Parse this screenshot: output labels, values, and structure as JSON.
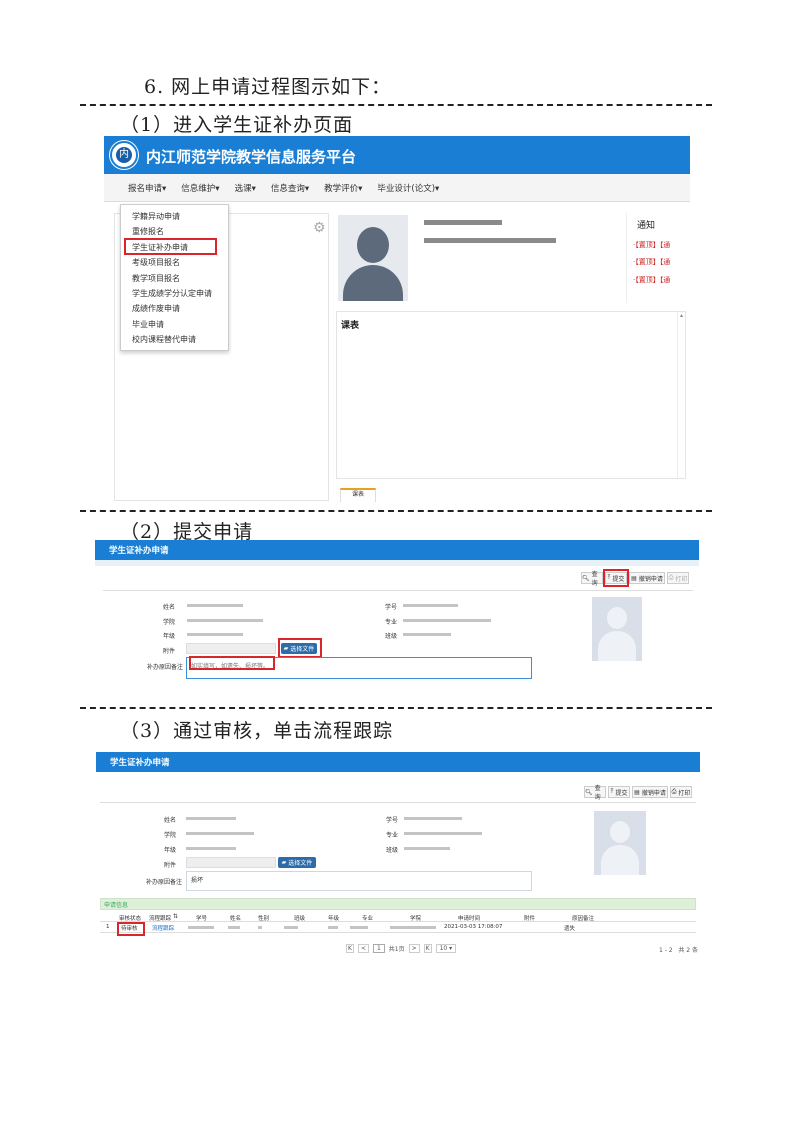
{
  "doc": {
    "title": "6. 网上申请过程图示如下：",
    "step1": "（1）进入学生证补办页面",
    "step2": "（2）提交申请",
    "step3": "（3）通过审核，单击流程跟踪"
  },
  "shot1": {
    "app_title": "内江师范学院教学信息服务平台",
    "nav": [
      "报名申请▾",
      "信息维护▾",
      "选课▾",
      "信息查询▾",
      "教学评价▾",
      "毕业设计(论文)▾"
    ],
    "menu": [
      "学籍异动申请",
      "重修报名",
      "学生证补办申请",
      "考级项目报名",
      "教学项目报名",
      "学生成绩学分认定申请",
      "成绩作废申请",
      "毕业申请",
      "校内课程替代申请"
    ],
    "notice_title": "通知",
    "notice_items": [
      "·【置顶】【通",
      "·【置顶】【通",
      "·【置顶】【通"
    ],
    "timetable_title": "课表",
    "tab_label": "课表"
  },
  "form": {
    "title": "学生证补办申请",
    "buttons": {
      "query": "查询",
      "submit": "提交",
      "cancel": "撤销申请",
      "print": "打印"
    },
    "labels": {
      "name": "姓名",
      "college": "学院",
      "grade": "年级",
      "attachment": "附件",
      "reason": "补办原因备注",
      "student_no": "学号",
      "major": "专业",
      "class": "班级"
    },
    "choose_file": "选择文件",
    "reason_placeholder": "如实填写，如遗失、损坏等。",
    "reason_value": "损坏"
  },
  "result": {
    "section_title": "申请信息",
    "columns": [
      "审核状态",
      "流程跟踪",
      "学号",
      "姓名",
      "性别",
      "班级",
      "年级",
      "专业",
      "学院",
      "申请时间",
      "附件",
      "原因备注"
    ],
    "row": {
      "index": "1",
      "status": "待审核",
      "track": "流程跟踪",
      "time": "2021-03-03 17:08:07",
      "reason": "遗失"
    },
    "pager": {
      "first": "K",
      "prev": "<",
      "page": "1",
      "of": "共1页",
      "next": ">",
      "last": "K",
      "size": "10",
      "count": "1 - 2   共 2 条"
    }
  }
}
